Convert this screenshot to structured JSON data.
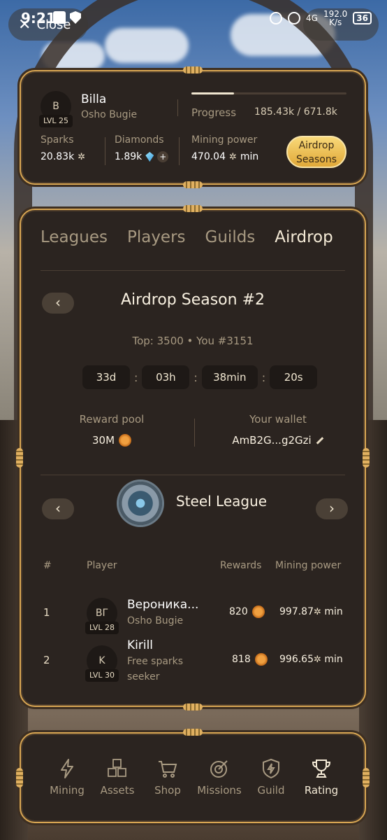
{
  "status": {
    "time": "9:21",
    "close_label": "Close",
    "net_type": "4G",
    "net_speed": "192.0",
    "net_unit": "K/s",
    "battery": "36"
  },
  "header": {
    "avatar_initial": "B",
    "level": "LVL 25",
    "name": "Billa",
    "subtitle": "Osho Bugie",
    "progress_label": "Progress",
    "progress_value": "185.43k  /  671.8k",
    "progress_fraction": 0.276,
    "sparks_label": "Sparks",
    "sparks_value": "20.83k",
    "diamonds_label": "Diamonds",
    "diamonds_value": "1.89k",
    "mining_label": "Mining power",
    "mining_value": "470.04",
    "mining_unit": "min",
    "airdrop_line1": "Airdrop",
    "airdrop_line2": "Seasons"
  },
  "tabs": [
    "Leagues",
    "Players",
    "Guilds",
    "Airdrop"
  ],
  "season": {
    "title": "Airdrop Season #2",
    "top_line": "Top: 3500 • You #3151",
    "timer": [
      "33d",
      "03h",
      "38min",
      "20s"
    ],
    "pool_label": "Reward pool",
    "pool_value": "30M",
    "wallet_label": "Your wallet",
    "wallet_value": "AmB2G...g2Gzi"
  },
  "league": {
    "name": "Steel League",
    "headers": {
      "num": "#",
      "player": "Player",
      "rewards": "Rewards",
      "power": "Mining power"
    },
    "rows": [
      {
        "rank": "1",
        "initials": "ВГ",
        "level": "LVL 28",
        "name": "Вероника...",
        "sub": "Osho Bugie",
        "reward": "820",
        "power": "997.87",
        "unit": "min"
      },
      {
        "rank": "2",
        "initials": "K",
        "level": "LVL 30",
        "name": "Kirill",
        "sub": "Free sparks seeker",
        "reward": "818",
        "power": "996.65",
        "unit": "min"
      }
    ]
  },
  "nav": [
    {
      "label": "Mining",
      "icon": "lightning-icon"
    },
    {
      "label": "Assets",
      "icon": "cubes-icon"
    },
    {
      "label": "Shop",
      "icon": "cart-icon"
    },
    {
      "label": "Missions",
      "icon": "target-icon"
    },
    {
      "label": "Guild",
      "icon": "shield-icon"
    },
    {
      "label": "Rating",
      "icon": "trophy-icon"
    }
  ],
  "colors": {
    "accent": "#d8a653",
    "panel": "#2b2420",
    "button_gold": "#f0c050"
  }
}
